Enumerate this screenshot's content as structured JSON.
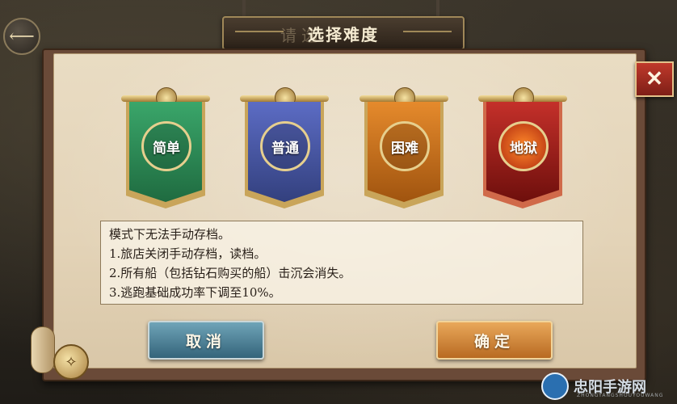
{
  "header": {
    "title": "选择难度",
    "title_shadow": "请选"
  },
  "navigation": {
    "back_icon": "arrow-left-icon",
    "close_icon": "close-icon",
    "close_symbol": "✕",
    "back_symbol": "⟵"
  },
  "difficulties": [
    {
      "label": "简单",
      "color": "#2e8b57"
    },
    {
      "label": "普通",
      "color": "#4a5aa8"
    },
    {
      "label": "困难",
      "color": "#c8741e"
    },
    {
      "label": "地狱",
      "color": "#a8201c"
    }
  ],
  "description": {
    "lines": [
      "模式下无法手动存档。",
      "1.旅店关闭手动存档，读档。",
      "2.所有船（包括钻石购买的船）击沉会消失。",
      "3.逃跑基础成功率下调至10%。"
    ]
  },
  "buttons": {
    "cancel_label": "取消",
    "confirm_label": "确定"
  },
  "watermark": {
    "text": "忠阳手游网",
    "sub": "ZHONGYANGSHOUYOUWANG"
  },
  "colors": {
    "accent_gold": "#c9a55a",
    "cancel_button": "#4f8aa0",
    "confirm_button": "#d68a3a",
    "close_button": "#b0302a"
  }
}
